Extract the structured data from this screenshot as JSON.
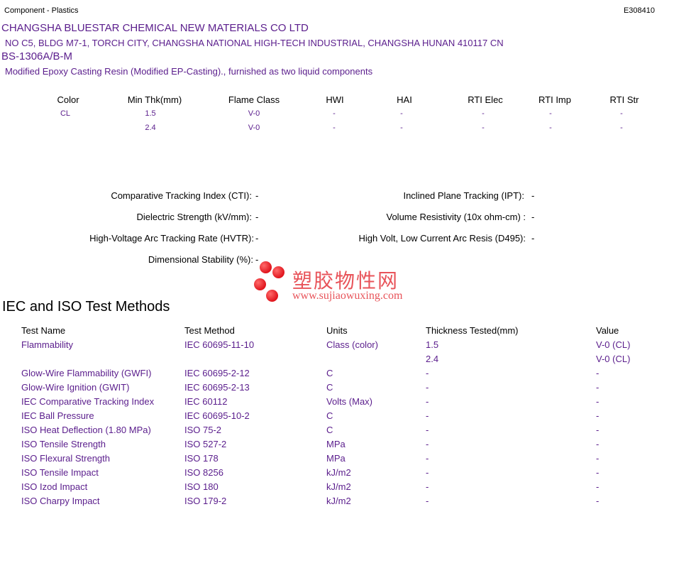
{
  "header": {
    "category": "Component - Plastics",
    "file_number": "E308410"
  },
  "company": {
    "name": "CHANGSHA BLUESTAR CHEMICAL NEW MATERIALS CO LTD",
    "address": "NO C5, BLDG M7-1, TORCH CITY, CHANGSHA NATIONAL HIGH-TECH INDUSTRIAL, CHANGSHA  HUNAN  410117 CN"
  },
  "product": {
    "grade": "BS-1306A/B-M",
    "description": "Modified Epoxy Casting Resin (Modified EP-Casting)., furnished as two liquid components"
  },
  "flame_table": {
    "headers": [
      "Color",
      "Min Thk(mm)",
      "Flame Class",
      "HWI",
      "HAI",
      "RTI Elec",
      "RTI Imp",
      "RTI Str"
    ],
    "rows": [
      [
        "CL",
        "1.5",
        "V-0",
        "-",
        "-",
        "-",
        "-",
        "-"
      ],
      [
        "",
        "2.4",
        "V-0",
        "-",
        "-",
        "-",
        "-",
        "-"
      ]
    ]
  },
  "properties": {
    "cti_label": "Comparative Tracking Index (CTI):",
    "cti_value": "-",
    "ipt_label": "Inclined Plane Tracking (IPT):",
    "ipt_value": "-",
    "ds_label": "Dielectric Strength (kV/mm):",
    "ds_value": "-",
    "vr_label": "Volume Resistivity (10x ohm-cm) :",
    "vr_value": "-",
    "hvtr_label": "High-Voltage Arc Tracking Rate (HVTR):",
    "hvtr_value": "-",
    "d495_label": "High Volt, Low Current Arc Resis (D495):",
    "d495_value": "-",
    "dim_label": "Dimensional Stability (%):",
    "dim_value": "-"
  },
  "watermark": {
    "chinese": "塑胶物性网",
    "url": "www.sujiaowuxing.com"
  },
  "iec": {
    "title": "IEC and ISO Test Methods",
    "headers": [
      "Test Name",
      "Test Method",
      "Units",
      "Thickness Tested(mm)",
      "Value"
    ],
    "rows": [
      [
        "Flammability",
        "IEC 60695-11-10",
        "Class (color)",
        "1.5",
        "V-0 (CL)"
      ],
      [
        "",
        "",
        "",
        "2.4",
        "V-0 (CL)"
      ],
      [
        "Glow-Wire Flammability (GWFI)",
        "IEC 60695-2-12",
        "C",
        "-",
        "-"
      ],
      [
        "Glow-Wire Ignition (GWIT)",
        "IEC 60695-2-13",
        "C",
        "-",
        "-"
      ],
      [
        "IEC Comparative Tracking Index",
        "IEC 60112",
        "Volts (Max)",
        "-",
        "-"
      ],
      [
        "IEC Ball Pressure",
        "IEC 60695-10-2",
        "C",
        "-",
        "-"
      ],
      [
        "ISO Heat Deflection (1.80 MPa)",
        "ISO 75-2",
        "C",
        "-",
        "-"
      ],
      [
        "ISO Tensile Strength",
        "ISO 527-2",
        "MPa",
        "-",
        "-"
      ],
      [
        "ISO Flexural Strength",
        "ISO 178",
        "MPa",
        "-",
        "-"
      ],
      [
        "ISO Tensile Impact",
        "ISO 8256",
        "kJ/m2",
        "-",
        "-"
      ],
      [
        "ISO Izod Impact",
        "ISO 180",
        "kJ/m2",
        "-",
        "-"
      ],
      [
        "ISO Charpy Impact",
        "ISO 179-2",
        "kJ/m2",
        "-",
        "-"
      ]
    ]
  },
  "colors": {
    "text_purple": "#5a1d8c",
    "watermark_red": "#e8545a"
  }
}
